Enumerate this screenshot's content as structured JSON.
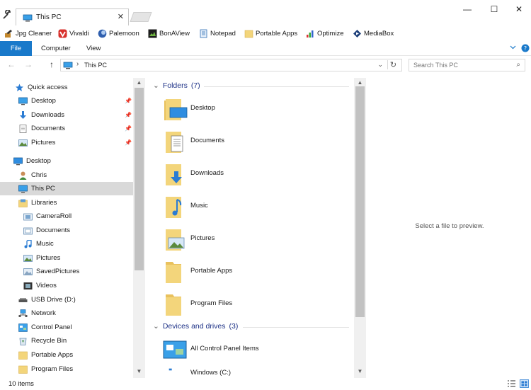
{
  "window": {
    "tab_title": "This PC",
    "tab_close": "✕",
    "minimize": "—",
    "maximize": "☐",
    "close": "✕"
  },
  "bookmarks": [
    {
      "label": "Jpg Cleaner",
      "icon": "jpg-cleaner-icon"
    },
    {
      "label": "Vivaldi",
      "icon": "vivaldi-icon"
    },
    {
      "label": "Palemoon",
      "icon": "palemoon-icon"
    },
    {
      "label": "BonAView",
      "icon": "bonaview-icon"
    },
    {
      "label": "Notepad",
      "icon": "notepad-icon"
    },
    {
      "label": "Portable Apps",
      "icon": "folder-icon"
    },
    {
      "label": "Optimize",
      "icon": "optimize-icon"
    },
    {
      "label": "MediaBox",
      "icon": "mediabox-icon"
    }
  ],
  "ribbon": {
    "file": "File",
    "computer": "Computer",
    "view": "View"
  },
  "address": {
    "back": "←",
    "forward": "→",
    "up": "↑",
    "separator": "›",
    "path": "This PC",
    "dropdown": "⌄",
    "refresh": "↻",
    "search_placeholder": "Search This PC",
    "search_icon": "⌕"
  },
  "nav": {
    "items": [
      {
        "label": "Quick access",
        "icon": "star-icon"
      },
      {
        "label": "Desktop",
        "icon": "desktop-icon"
      },
      {
        "label": "Downloads",
        "icon": "downloads-icon"
      },
      {
        "label": "Documents",
        "icon": "documents-icon"
      },
      {
        "label": "Pictures",
        "icon": "pictures-icon"
      },
      {
        "label": "Desktop",
        "icon": "desktop-icon"
      },
      {
        "label": "Chris",
        "icon": "user-icon"
      },
      {
        "label": "This PC",
        "icon": "pc-icon"
      },
      {
        "label": "Libraries",
        "icon": "libraries-icon"
      },
      {
        "label": "CameraRoll",
        "icon": "library-icon"
      },
      {
        "label": "Documents",
        "icon": "library-icon"
      },
      {
        "label": "Music",
        "icon": "music-icon"
      },
      {
        "label": "Pictures",
        "icon": "pictures-icon"
      },
      {
        "label": "SavedPictures",
        "icon": "pictures-icon"
      },
      {
        "label": "Videos",
        "icon": "videos-icon"
      },
      {
        "label": "USB Drive (D:)",
        "icon": "usb-drive-icon"
      },
      {
        "label": "Network",
        "icon": "network-icon"
      },
      {
        "label": "Control Panel",
        "icon": "control-panel-icon"
      },
      {
        "label": "Recycle Bin",
        "icon": "recycle-bin-icon"
      },
      {
        "label": "Portable Apps",
        "icon": "folder-icon"
      },
      {
        "label": "Program Files",
        "icon": "folder-icon"
      }
    ],
    "pin": "📌",
    "scroll_up": "▲",
    "scroll_down": "▼"
  },
  "content": {
    "folders_group": "Folders",
    "folders_count": "(7)",
    "devices_group": "Devices and drives",
    "devices_count": "(3)",
    "folders": [
      "Desktop",
      "Documents",
      "Downloads",
      "Music",
      "Pictures",
      "Portable Apps",
      "Program Files"
    ],
    "devices": [
      "All Control Panel Items",
      "Windows (C:)"
    ],
    "chevron": "⌄",
    "scroll_up": "▲",
    "scroll_down": "▼"
  },
  "preview": {
    "message": "Select a file to preview."
  },
  "status": {
    "count": "10 items"
  },
  "colors": {
    "accent": "#1979ca",
    "group_header": "#1e3287",
    "folder": "#f3d57b"
  }
}
